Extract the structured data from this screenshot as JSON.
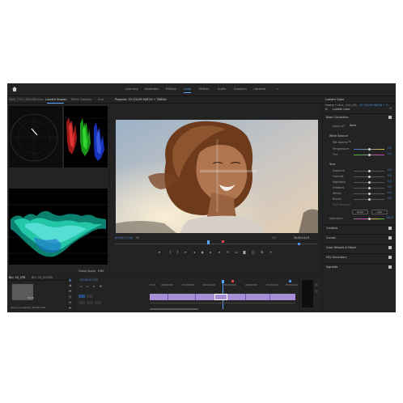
{
  "workspaces": [
    "Learning",
    "Assembly",
    "Editing",
    "Color",
    "Effects",
    "Audio",
    "Graphics",
    "Libraries"
  ],
  "workspace_active": "Color",
  "workspace_more": "»",
  "scopes_panel": {
    "tabs": [
      "3301_7211_SD1000.mov",
      "Lumetri Scopes",
      "Effect Controls",
      "Aud"
    ],
    "active_tab": "Lumetri Scopes",
    "clamp_label": "Clamp Signal",
    "bit_label": "8 Bit"
  },
  "program_monitor": {
    "title": "Program: 03 COLOR MATCH + TWEAK",
    "timecode_left": "00;00;17;04",
    "fit": "Fit",
    "quality": "1/2",
    "timecode_right": "00;00;04;03"
  },
  "project_panel": {
    "tabs": [
      "Bin: 03_CPB",
      "Bin: 03_SOUND"
    ],
    "clip_name": "Jasmine_Gingerhair_SD1000_SD1",
    "clip_duration": "01;28"
  },
  "timeline": {
    "timecode": "00;00;17;04",
    "ruler": [
      "00;00",
      "00;00;04;00",
      "00;00;08;00",
      "00;00;12;00",
      "00;00;16;00",
      "00;00;20;00",
      "00;00;24;00",
      "00;00;28;00"
    ]
  },
  "lumetri": {
    "panel_title": "Lumetri Color",
    "master_label": "Master * 3301_7211_SD...",
    "sequence_label": "03 COLOR MATCH + T...",
    "fx_label": "fx",
    "effect_name": "Lumetri Color",
    "basic_correction": "Basic Correction",
    "input_lut_label": "Input LUT",
    "input_lut_value": "None",
    "white_balance": "White Balance",
    "wb_selector": "WB Selector",
    "temperature": {
      "label": "Temperature",
      "value": "0.0"
    },
    "tint": {
      "label": "Tint",
      "value": "0.0"
    },
    "tone": "Tone",
    "exposure": {
      "label": "Exposure",
      "value": "0.0"
    },
    "contrast": {
      "label": "Contrast",
      "value": "0.0"
    },
    "highlights": {
      "label": "Highlights",
      "value": "0.0"
    },
    "shadows": {
      "label": "Shadows",
      "value": "0.0"
    },
    "whites": {
      "label": "Whites",
      "value": "0.0"
    },
    "blacks": {
      "label": "Blacks",
      "value": "0.0"
    },
    "hdr_specular": "HDR Specular",
    "reset_button": "Reset",
    "auto_button": "Auto",
    "saturation": {
      "label": "Saturation",
      "value": "100.0"
    },
    "sections": [
      "Creative",
      "Curves",
      "Color Wheels & Match",
      "HSL Secondary",
      "Vignette"
    ]
  },
  "colors": {
    "accent": "#4a8fe0",
    "playhead": "#5aa2ff",
    "marker_red": "#e04545",
    "clip": "#a78fd6"
  }
}
